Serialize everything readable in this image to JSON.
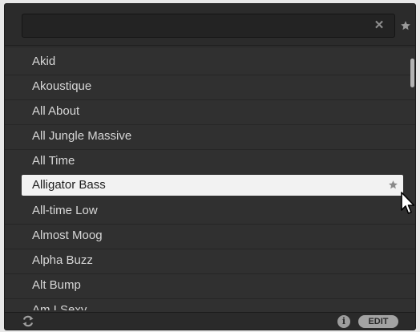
{
  "search": {
    "value": "",
    "placeholder": ""
  },
  "icons": {
    "clear": "close-icon",
    "favorite": "star-icon",
    "refresh": "refresh-icon",
    "info": "info-icon",
    "cursor": "mouse-pointer-icon"
  },
  "list": {
    "items": [
      {
        "label": "Akid",
        "selected": false
      },
      {
        "label": "Akoustique",
        "selected": false
      },
      {
        "label": "All About",
        "selected": false
      },
      {
        "label": "All Jungle Massive",
        "selected": false
      },
      {
        "label": "All Time",
        "selected": false
      },
      {
        "label": "Alligator Bass",
        "selected": true,
        "favorite": true
      },
      {
        "label": "All-time Low",
        "selected": false
      },
      {
        "label": "Almost Moog",
        "selected": false
      },
      {
        "label": "Alpha Buzz",
        "selected": false
      },
      {
        "label": "Alt Bump",
        "selected": false
      },
      {
        "label": "Am I Sexy",
        "selected": false
      }
    ]
  },
  "footer": {
    "info_glyph": "i",
    "edit_label": "EDIT"
  },
  "colors": {
    "panel_bg": "#303030",
    "selected_bg": "#f2f2f2",
    "text": "#d7d7d7",
    "selected_text": "#1d1d1d",
    "icon": "#9d9d9d"
  }
}
